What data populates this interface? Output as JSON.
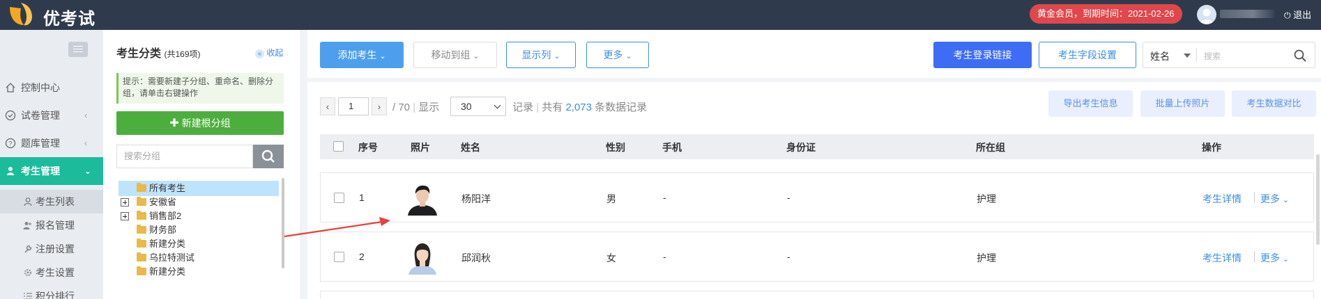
{
  "app": {
    "title": "优考试"
  },
  "header": {
    "member_badge": "黄金会员，到期时间：2021-02-26",
    "logout": "退出"
  },
  "nav": {
    "items": [
      {
        "label": "控制中心",
        "icon": "home-icon"
      },
      {
        "label": "试卷管理",
        "icon": "check-circle-icon"
      },
      {
        "label": "题库管理",
        "icon": "question-circle-icon"
      },
      {
        "label": "考生管理",
        "icon": "user-icon"
      }
    ],
    "sub_items": [
      {
        "label": "考生列表",
        "icon": "user-outline-icon"
      },
      {
        "label": "报名管理",
        "icon": "users-icon"
      },
      {
        "label": "注册设置",
        "icon": "wrench-icon"
      },
      {
        "label": "考生设置",
        "icon": "gear-icon"
      },
      {
        "label": "积分排行",
        "icon": "list-icon"
      }
    ]
  },
  "categories": {
    "title": "考生分类",
    "count": "(共169项)",
    "collapse": "收起",
    "tip": "提示：需要新建子分组、重命名、删除分组，请单击右键操作",
    "new_root": "新建根分组",
    "search_placeholder": "搜索分组",
    "tree": [
      {
        "label": "所有考生",
        "expandable": false,
        "selected": true
      },
      {
        "label": "安徽省",
        "expandable": true,
        "selected": false
      },
      {
        "label": "销售部2",
        "expandable": true,
        "selected": false
      },
      {
        "label": "财务部",
        "expandable": false,
        "selected": false
      },
      {
        "label": "新建分类",
        "expandable": false,
        "selected": false
      },
      {
        "label": "乌拉特测试",
        "expandable": false,
        "selected": false
      },
      {
        "label": "新建分类",
        "expandable": false,
        "selected": false
      }
    ]
  },
  "toolbar": {
    "add": "添加考生",
    "move": "移动到组",
    "columns": "显示列",
    "more": "更多",
    "login_link": "考生登录链接",
    "field_settings": "考生字段设置",
    "search_field": "姓名",
    "search_placeholder": "搜索"
  },
  "pager": {
    "page": "1",
    "total_pages": "/ 70",
    "show_label": "显示",
    "per_page": "30",
    "records_label": "记录",
    "total_prefix": "共有",
    "total": "2,073",
    "total_suffix": "条数据记录"
  },
  "actions": {
    "export": "导出考生信息",
    "upload_photos": "批量上传照片",
    "compare": "考生数据对比"
  },
  "table": {
    "columns": [
      "序号",
      "照片",
      "姓名",
      "性别",
      "手机",
      "身份证",
      "所在组",
      "操作"
    ],
    "rows": [
      {
        "index": "1",
        "name": "杨阳洋",
        "gender": "男",
        "phone": "-",
        "id_card": "-",
        "group": "护理",
        "detail": "考生详情",
        "more": "更多"
      },
      {
        "index": "2",
        "name": "邱润秋",
        "gender": "女",
        "phone": "-",
        "id_card": "-",
        "group": "护理",
        "detail": "考生详情",
        "more": "更多"
      }
    ]
  },
  "colors": {
    "topbar": "#2f3b4d",
    "accent_green": "#1cbb9b",
    "member_red": "#e0474c",
    "primary_blue": "#3d6df5",
    "annotation_arrow": "#e8403a"
  }
}
